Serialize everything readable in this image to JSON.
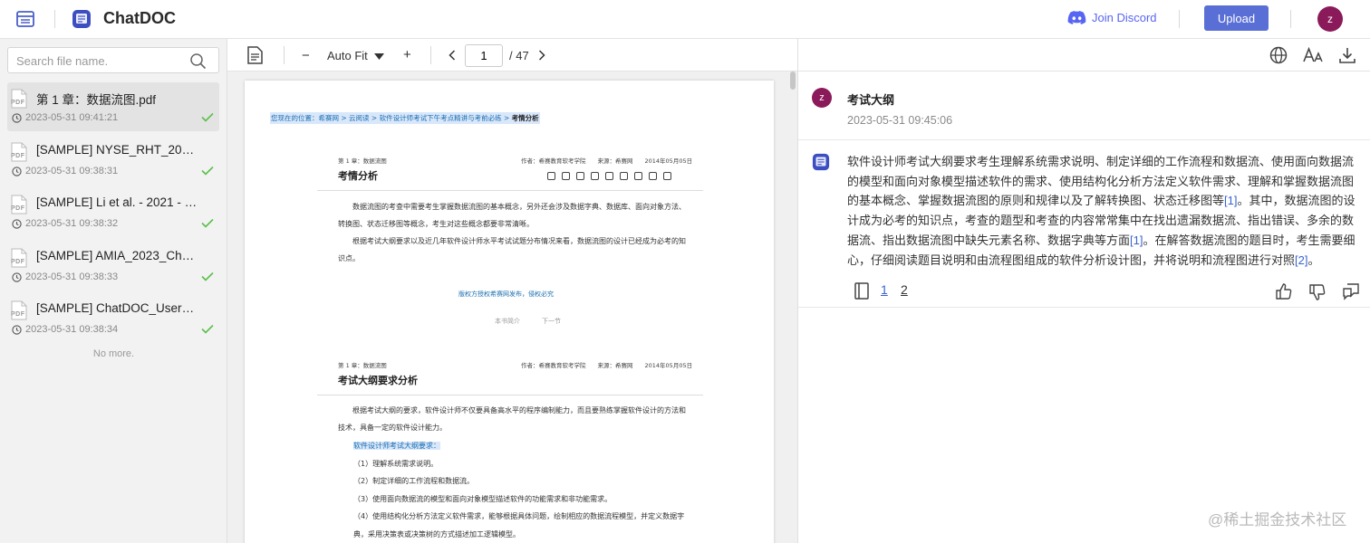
{
  "app": {
    "name": "ChatDOC",
    "join_discord": "Join Discord",
    "upload": "Upload",
    "user_initial": "z",
    "colors": {
      "accent": "#5a6fd6",
      "discord": "#5865f2",
      "avatar": "#8a1a5a",
      "link": "#3a63d0"
    }
  },
  "sidebar": {
    "search_placeholder": "Search file name.",
    "files": [
      {
        "name": "第 1 章：数据流图.pdf",
        "date": "2023-05-31 09:41:21",
        "active": true
      },
      {
        "name": "[SAMPLE] NYSE_RHT_2019_...",
        "date": "2023-05-31 09:38:31"
      },
      {
        "name": "[SAMPLE] Li et al. - 2021 - Se...",
        "date": "2023-05-31 09:38:32"
      },
      {
        "name": "[SAMPLE] AMIA_2023_Chat...",
        "date": "2023-05-31 09:38:33"
      },
      {
        "name": "[SAMPLE] ChatDOC_User_G...",
        "date": "2023-05-31 09:38:34"
      }
    ],
    "file_icon_label": "PDF",
    "no_more": "No more."
  },
  "viewer": {
    "zoom_minus": "−",
    "zoom_mode": "Auto Fit",
    "zoom_plus": "+",
    "page_current": "1",
    "page_total": "/ 47"
  },
  "doc": {
    "breadcrumb_prefix": "您现在的位置：希赛网 > 云阅读 > 软件设计师考试下午考点精讲与考前必练 > ",
    "breadcrumb_current": "考情分析",
    "section1": {
      "chapter": "第 1 章：数据流图",
      "meta": "作者：希赛教育软考学院　　来源：希赛网　　2014年05月05日",
      "title": "考情分析",
      "p1": "数据流图的考查中需要考生掌握数据流图的基本概念，另外还会涉及数据字典、数据库、面向对象方法、转换图、状态迁移图等概念，考生对这些概念都要非常清晰。",
      "p2": "根据考试大纲要求以及近几年软件设计师水平考试试题分布情况来看，数据流图的设计已经成为必考的知识点。",
      "copyright": "版权方授权希赛网发布，侵权必究",
      "nav_prev": "本书简介",
      "nav_next": "下一节"
    },
    "section2": {
      "chapter": "第 1 章：数据流图",
      "meta": "作者：希赛教育软考学院　　来源：希赛网　　2014年05月05日",
      "title": "考试大纲要求分析",
      "intro": "根据考试大纲的要求，软件设计师不仅要具备高水平的程序编制能力，而且要熟练掌握软件设计的方法和技术，具备一定的软件设计能力。",
      "highlight": "软件设计师考试大纲要求：",
      "items": [
        "（1）理解系统需求说明。",
        "（2）制定详细的工作流程和数据流。",
        "（3）使用面向数据流的模型和面向对象模型描述软件的功能需求和非功能需求。",
        "（4）使用结构化分析方法定义软件需求，能够根据具体问题，绘制相应的数据流程模型，并定义数据字典，采用决策表或决策树的方式描述加工逻辑模型。"
      ]
    }
  },
  "chat": {
    "question": "考试大纲",
    "question_time": "2023-05-31 09:45:06",
    "answer": {
      "t1": "软件设计师考试大纲要求考生理解系统需求说明、制定详细的工作流程和数据流、使用面向数据流的模型和面向对象模型描述软件的需求、使用结构化分析方法定义软件需求、理解和掌握数据流图的基本概念、掌握数据流图的原则和规律以及了解转换图、状态迁移图等",
      "r1": "[1]",
      "t2": "。其中，数据流图的设计成为必考的知识点，考查的题型和考查的内容常常集中在找出遗漏数据流、指出错误、多余的数据流、指出数据流图中缺失元素名称、数据字典等方面",
      "r2": "[1]",
      "t3": "。在解答数据流图的题目时，考生需要细心，仔细阅读题目说明和由流程图组成的软件分析设计图，并将说明和流程图进行对照",
      "r3": "[2]",
      "t4": "。"
    },
    "refs": [
      "1",
      "2"
    ]
  },
  "watermark": "@稀土掘金技术社区"
}
